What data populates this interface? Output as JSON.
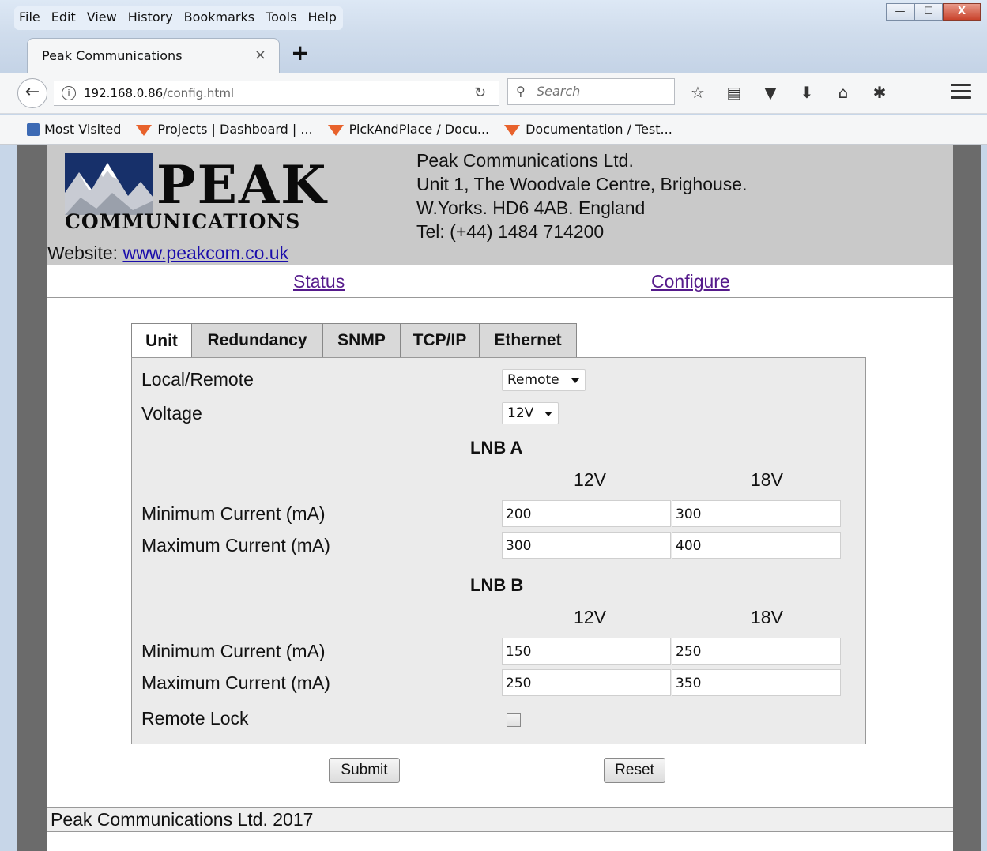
{
  "browser": {
    "menu": [
      "File",
      "Edit",
      "View",
      "History",
      "Bookmarks",
      "Tools",
      "Help"
    ],
    "window_controls": {
      "minimize": "—",
      "maximize": "☐",
      "close": "X"
    },
    "tab": {
      "title": "Peak Communications",
      "close": "×",
      "new_tab": "+"
    },
    "url": {
      "host": "192.168.0.86",
      "path": "/config.html"
    },
    "search_placeholder": "Search",
    "bookmarks": [
      "Most Visited",
      "Projects | Dashboard | ...",
      "PickAndPlace / Docu...",
      "Documentation / Test..."
    ]
  },
  "header": {
    "logo_word": "PEAK",
    "logo_sub": "COMMUNICATIONS",
    "address": [
      "Peak Communications Ltd.",
      "Unit 1, The Woodvale Centre, Brighouse.",
      "W.Yorks. HD6 4AB. England",
      "Tel: (+44) 1484 714200"
    ],
    "website_label": "Website:",
    "website_link": "www.peakcom.co.uk"
  },
  "nav": {
    "status": "Status",
    "configure": "Configure"
  },
  "tabs": [
    "Unit",
    "Redundancy",
    "SNMP",
    "TCP/IP",
    "Ethernet"
  ],
  "form": {
    "local_remote": {
      "label": "Local/Remote",
      "value": "Remote"
    },
    "voltage": {
      "label": "Voltage",
      "value": "12V"
    },
    "col_12v": "12V",
    "col_18v": "18V",
    "lnb_a": {
      "title": "LNB A",
      "min_label": "Minimum Current (mA)",
      "max_label": "Maximum Current (mA)",
      "min_12v": "200",
      "min_18v": "300",
      "max_12v": "300",
      "max_18v": "400"
    },
    "lnb_b": {
      "title": "LNB B",
      "min_label": "Minimum Current (mA)",
      "max_label": "Maximum Current (mA)",
      "min_12v": "150",
      "min_18v": "250",
      "max_12v": "250",
      "max_18v": "350"
    },
    "remote_lock": {
      "label": "Remote Lock",
      "checked": false
    },
    "submit": "Submit",
    "reset": "Reset"
  },
  "footer": "Peak Communications Ltd. 2017"
}
